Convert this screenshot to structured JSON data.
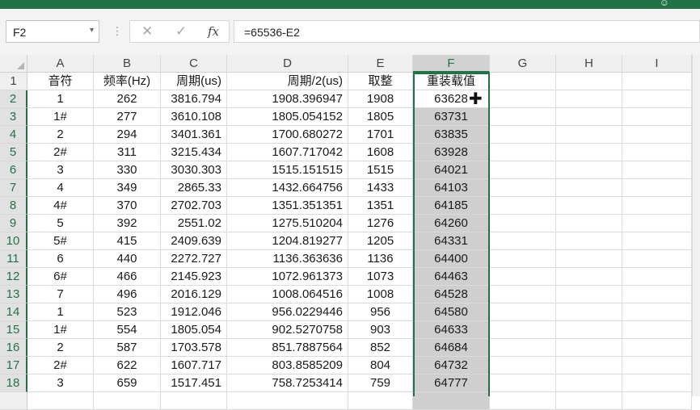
{
  "ribbon": {
    "corner_glyph": "☺"
  },
  "formula_bar": {
    "name_box": "F2",
    "name_box_arrow": "▾",
    "separator": "⋮",
    "cancel_glyph": "✕",
    "enter_glyph": "✓",
    "fx_label": "fx",
    "formula": "=65536-E2"
  },
  "columns": [
    "A",
    "B",
    "C",
    "D",
    "E",
    "F",
    "G",
    "H",
    "I"
  ],
  "rows": [
    {
      "num": "1",
      "a": "音符",
      "b": "频率(Hz)",
      "c": "周期(us)",
      "d": "周期/2(us)",
      "e": "取整",
      "f": "重装载值"
    },
    {
      "num": "2",
      "a": "1",
      "b": "262",
      "c": "3816.794",
      "d": "1908.396947",
      "e": "1908",
      "f": "63628"
    },
    {
      "num": "3",
      "a": "1#",
      "b": "277",
      "c": "3610.108",
      "d": "1805.054152",
      "e": "1805",
      "f": "63731"
    },
    {
      "num": "4",
      "a": "2",
      "b": "294",
      "c": "3401.361",
      "d": "1700.680272",
      "e": "1701",
      "f": "63835"
    },
    {
      "num": "5",
      "a": "2#",
      "b": "311",
      "c": "3215.434",
      "d": "1607.717042",
      "e": "1608",
      "f": "63928"
    },
    {
      "num": "6",
      "a": "3",
      "b": "330",
      "c": "3030.303",
      "d": "1515.151515",
      "e": "1515",
      "f": "64021"
    },
    {
      "num": "7",
      "a": "4",
      "b": "349",
      "c": "2865.33",
      "d": "1432.664756",
      "e": "1433",
      "f": "64103"
    },
    {
      "num": "8",
      "a": "4#",
      "b": "370",
      "c": "2702.703",
      "d": "1351.351351",
      "e": "1351",
      "f": "64185"
    },
    {
      "num": "9",
      "a": "5",
      "b": "392",
      "c": "2551.02",
      "d": "1275.510204",
      "e": "1276",
      "f": "64260"
    },
    {
      "num": "10",
      "a": "5#",
      "b": "415",
      "c": "2409.639",
      "d": "1204.819277",
      "e": "1205",
      "f": "64331"
    },
    {
      "num": "11",
      "a": "6",
      "b": "440",
      "c": "2272.727",
      "d": "1136.363636",
      "e": "1136",
      "f": "64400"
    },
    {
      "num": "12",
      "a": "6#",
      "b": "466",
      "c": "2145.923",
      "d": "1072.961373",
      "e": "1073",
      "f": "64463"
    },
    {
      "num": "13",
      "a": "7",
      "b": "496",
      "c": "2016.129",
      "d": "1008.064516",
      "e": "1008",
      "f": "64528"
    },
    {
      "num": "14",
      "a": "1",
      "b": "523",
      "c": "1912.046",
      "d": "956.0229446",
      "e": "956",
      "f": "64580"
    },
    {
      "num": "15",
      "a": "1#",
      "b": "554",
      "c": "1805.054",
      "d": "902.5270758",
      "e": "903",
      "f": "64633"
    },
    {
      "num": "16",
      "a": "2",
      "b": "587",
      "c": "1703.578",
      "d": "851.7887564",
      "e": "852",
      "f": "64684"
    },
    {
      "num": "17",
      "a": "2#",
      "b": "622",
      "c": "1607.717",
      "d": "803.8585209",
      "e": "804",
      "f": "64732"
    },
    {
      "num": "18",
      "a": "3",
      "b": "659",
      "c": "1517.451",
      "d": "758.7253414",
      "e": "759",
      "f": "64777"
    }
  ],
  "cursor_glyph": "✚",
  "colors": {
    "accent": "#217346",
    "selection_fill": "#cfcfcf"
  }
}
